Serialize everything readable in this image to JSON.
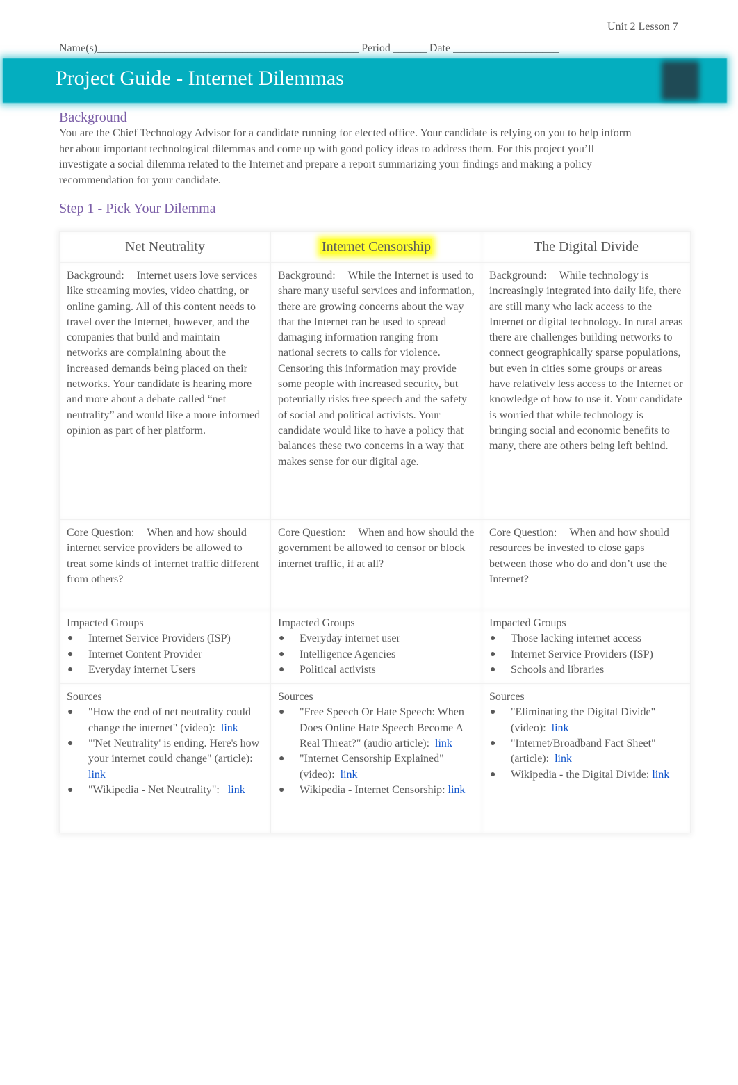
{
  "header": {
    "unit_label": "Unit 2 Lesson 7",
    "name_line": "Name(s)_______________________________________________ Period ______ Date ___________________",
    "title": "Project Guide - Internet Dilemmas",
    "logo_icon": "code-org-logo-icon"
  },
  "background": {
    "heading": "Background",
    "paragraph": "You are the Chief Technology Advisor for a candidate running for elected office. Your candidate is relying on you to help inform her about important technological dilemmas and come up with good policy ideas to address them. For this project you’ll investigate a social dilemma related to the Internet and prepare a report summarizing your findings and making a policy recommendation for your candidate."
  },
  "step1": {
    "heading": "Step 1 - Pick Your Dilemma"
  },
  "dilemmas": [
    {
      "title": "Net Neutrality",
      "highlighted": false,
      "background_label": "Background:",
      "background_text": "Internet users love services like streaming movies, video chatting, or online gaming. All of this content needs to travel over the Internet, however, and the companies that build and maintain networks are complaining about the increased demands being placed on their networks. Your candidate is hearing more and more about a debate called “net neutrality” and would like a more informed opinion as part of her platform.",
      "core_label": "Core Question:",
      "core_text": "When and how should internet service providers be allowed to treat some kinds of internet traffic different from others?",
      "groups_label": "Impacted Groups",
      "groups": [
        "Internet Service Providers (ISP)",
        "Internet Content Provider",
        "Everyday internet Users"
      ],
      "sources_label": "Sources",
      "sources": [
        {
          "text": "\"How the end of net neutrality could change the internet\" (video):",
          "link": "link"
        },
        {
          "text": "\"'Net Neutrality' is ending. Here's how your internet could change\" (article):",
          "link": "link"
        },
        {
          "text": "\"Wikipedia - Net Neutrality\":",
          "link": "link"
        }
      ]
    },
    {
      "title": "Internet Censorship",
      "highlighted": true,
      "background_label": "Background:",
      "background_text": "While the Internet is used to share many useful services and information, there are growing concerns about the way that the Internet can be used to spread damaging information ranging from national secrets to calls for violence. Censoring this information may provide some people with increased security, but potentially risks free speech and the safety of social and political activists. Your candidate would like to have a policy that balances these two concerns in a way that makes sense for our digital age.",
      "core_label": "Core Question:",
      "core_text": "When and how should the government be allowed to censor or block internet traffic, if at all?",
      "groups_label": "Impacted Groups",
      "groups": [
        "Everyday internet user",
        "Intelligence Agencies",
        "Political activists"
      ],
      "sources_label": "Sources",
      "sources": [
        {
          "text": "\"Free Speech Or Hate Speech: When Does Online Hate Speech Become A Real Threat?\" (audio article):",
          "link": "link"
        },
        {
          "text": "\"Internet Censorship Explained\" (video):",
          "link": "link"
        },
        {
          "text": "Wikipedia - Internet Censorship:",
          "link": "link"
        }
      ]
    },
    {
      "title": "The Digital Divide",
      "highlighted": false,
      "background_label": "Background:",
      "background_text": "While technology is increasingly integrated into daily life, there are still many who lack access to the Internet or digital technology. In rural areas there are challenges building networks to connect geographically sparse populations, but even in cities some groups or areas have relatively less access to the Internet or knowledge of how to use it. Your candidate is worried that while technology is bringing social and economic benefits to many, there are others being left behind.",
      "core_label": "Core Question:",
      "core_text": "When and how should resources be invested to close gaps between those who do and don’t use the Internet?",
      "groups_label": "Impacted Groups",
      "groups": [
        "Those lacking internet access",
        "Internet Service Providers (ISP)",
        "Schools and libraries"
      ],
      "sources_label": "Sources",
      "sources": [
        {
          "text": "\"Eliminating the Digital Divide\" (video):",
          "link": "link"
        },
        {
          "text": "\"Internet/Broadband Fact Sheet\" (article):",
          "link": "link"
        },
        {
          "text": "Wikipedia - the Digital Divide:",
          "link": "link"
        }
      ]
    }
  ],
  "colors": {
    "banner": "#04aebf",
    "heading_purple": "#7b5ea7",
    "link_blue": "#1155cc",
    "highlight": "#ffff33",
    "body_text": "#595959"
  }
}
